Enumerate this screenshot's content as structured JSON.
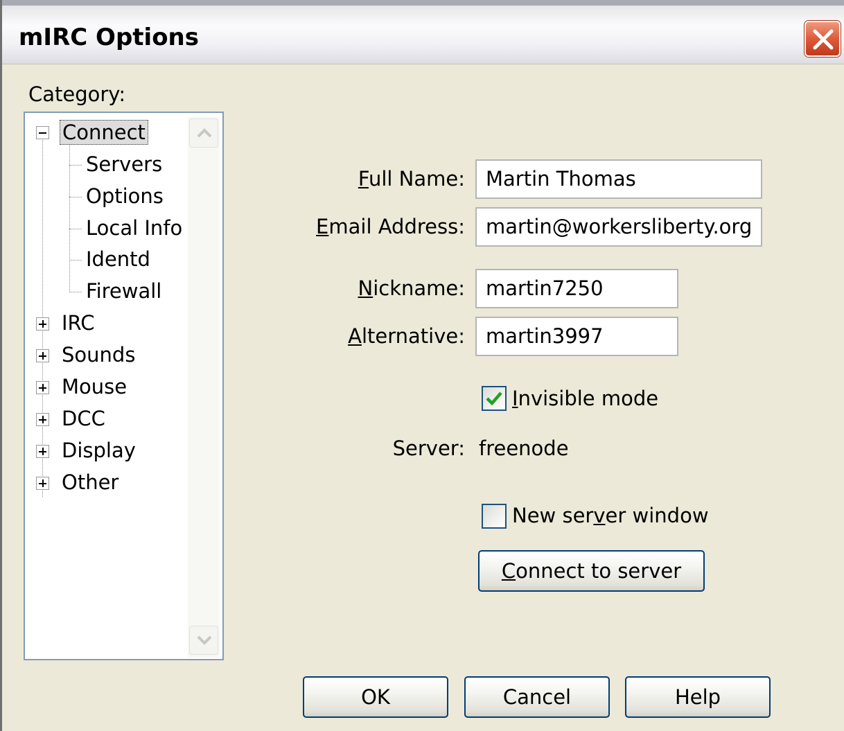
{
  "window": {
    "title": "mIRC Options",
    "close_icon": "close-x-icon"
  },
  "category": {
    "label": "Category:",
    "tree": {
      "connect": {
        "label": "Connect",
        "expanded": true,
        "selected": true,
        "children": [
          "Servers",
          "Options",
          "Local Info",
          "Identd",
          "Firewall"
        ]
      },
      "collapsed": [
        "IRC",
        "Sounds",
        "Mouse",
        "DCC",
        "Display",
        "Other"
      ]
    }
  },
  "form": {
    "full_name": {
      "label_first": "F",
      "label_rest": "ull Name:",
      "value": "Martin Thomas"
    },
    "email": {
      "label_first": "E",
      "label_rest": "mail Address:",
      "value": "martin@workersliberty.org"
    },
    "nickname": {
      "label_first": "N",
      "label_rest": "ickname:",
      "value": "martin7250"
    },
    "alternative": {
      "label_first": "A",
      "label_rest": "lternative:",
      "value": "martin3997"
    },
    "invisible_mode": {
      "label_first": "I",
      "label_rest": "nvisible mode",
      "checked": true
    },
    "server": {
      "label": "Server:",
      "value": "freenode"
    },
    "new_server_window": {
      "label_pre": "New ser",
      "label_u": "v",
      "label_post": "er window",
      "checked": false
    },
    "connect_button": {
      "label_first": "C",
      "label_rest": "onnect to server"
    }
  },
  "buttons": {
    "ok": "OK",
    "cancel": "Cancel",
    "help": "Help"
  }
}
